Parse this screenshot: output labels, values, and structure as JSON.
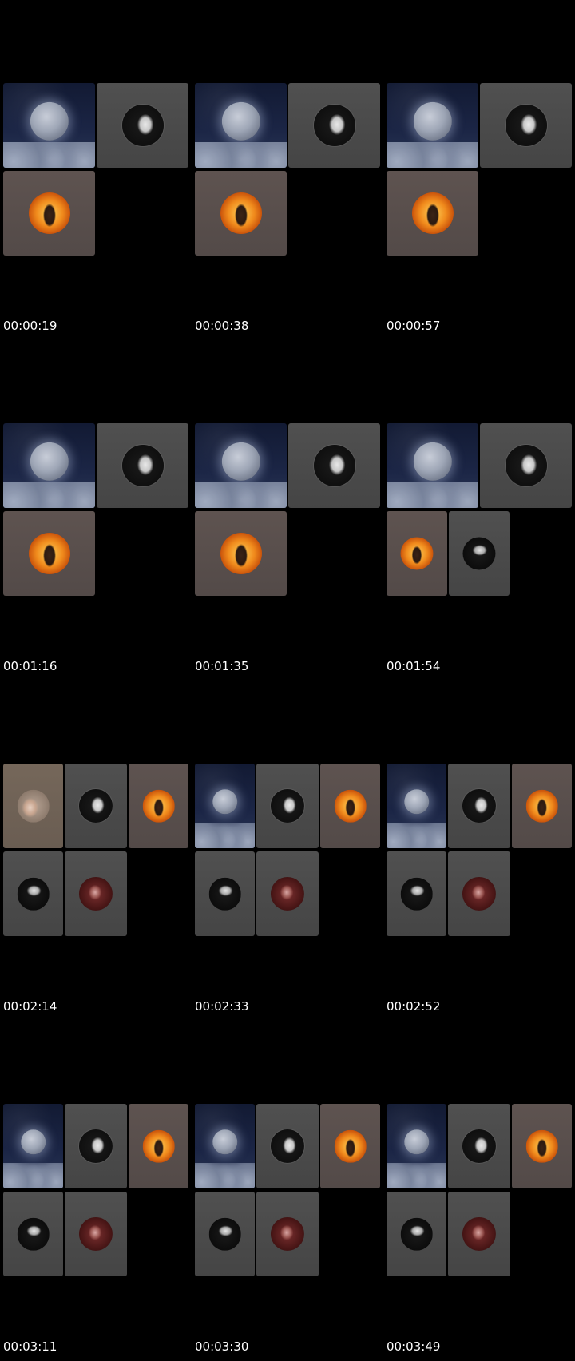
{
  "frames": [
    {
      "timestamp": "00:00:19",
      "tiles": [
        "moon-tile",
        "woman-avatar-tile",
        "fire-avatar-tile"
      ]
    },
    {
      "timestamp": "00:00:38",
      "tiles": [
        "moon-tile",
        "woman-avatar-tile",
        "fire-avatar-tile"
      ]
    },
    {
      "timestamp": "00:00:57",
      "tiles": [
        "moon-tile",
        "woman-avatar-tile",
        "fire-avatar-tile"
      ]
    },
    {
      "timestamp": "00:01:16",
      "tiles": [
        "moon-tile",
        "woman-avatar-tile",
        "fire-avatar-tile"
      ]
    },
    {
      "timestamp": "00:01:35",
      "tiles": [
        "moon-tile",
        "woman-avatar-tile",
        "fire-avatar-tile"
      ]
    },
    {
      "timestamp": "00:01:54",
      "tiles": [
        "moon-tile",
        "woman-avatar-tile",
        "fire-avatar-tile",
        "mono-avatar-tile"
      ]
    },
    {
      "timestamp": "00:02:14",
      "tiles": [
        "hand-avatar-tile",
        "woman-avatar-tile",
        "fire-avatar-tile",
        "mono-avatar-tile",
        "red-avatar-tile"
      ]
    },
    {
      "timestamp": "00:02:33",
      "tiles": [
        "moon-tile",
        "woman-avatar-tile",
        "fire-avatar-tile",
        "mono-avatar-tile",
        "red-avatar-tile"
      ]
    },
    {
      "timestamp": "00:02:52",
      "tiles": [
        "moon-tile",
        "woman-avatar-tile",
        "fire-avatar-tile",
        "mono-avatar-tile",
        "red-avatar-tile"
      ]
    },
    {
      "timestamp": "00:03:11",
      "tiles": [
        "moon-tile",
        "woman-avatar-tile",
        "fire-avatar-tile",
        "mono-avatar-tile",
        "red-avatar-tile"
      ]
    },
    {
      "timestamp": "00:03:30",
      "tiles": [
        "moon-tile",
        "woman-avatar-tile",
        "fire-avatar-tile",
        "mono-avatar-tile",
        "red-avatar-tile"
      ]
    },
    {
      "timestamp": "00:03:49",
      "tiles": [
        "moon-tile",
        "woman-avatar-tile",
        "fire-avatar-tile",
        "mono-avatar-tile",
        "red-avatar-tile"
      ]
    }
  ]
}
